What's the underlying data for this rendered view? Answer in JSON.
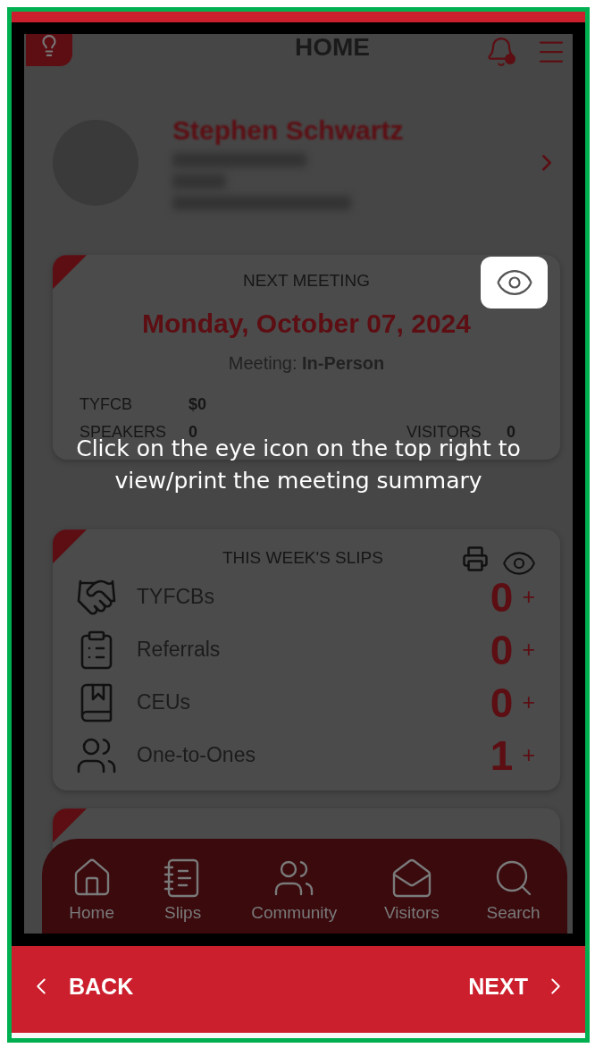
{
  "header": {
    "title": "HOME"
  },
  "profile": {
    "name": "Stephen Schwartz"
  },
  "next_meeting": {
    "heading": "NEXT MEETING",
    "date": "Monday, October 07, 2024",
    "meeting_type": "Meeting: **In-Person**",
    "stats": [
      {
        "label": "TYFCB",
        "value": "$0"
      },
      {
        "label": "SPEAKERS",
        "value": "0"
      },
      {
        "label": "VISITORS",
        "value": "0"
      }
    ]
  },
  "slips": {
    "heading": "THIS WEEK'S SLIPS",
    "rows": [
      {
        "kind": "tyfcb",
        "label": "TYFCBs",
        "count": "0",
        "add": "+"
      },
      {
        "kind": "referral",
        "label": "Referrals",
        "count": "0",
        "add": "+"
      },
      {
        "kind": "ceu",
        "label": "CEUs",
        "count": "0",
        "add": "+"
      },
      {
        "kind": "one_to_one",
        "label": "One-to-Ones",
        "count": "1",
        "add": "+"
      }
    ]
  },
  "bottom_nav": [
    {
      "label": "Home"
    },
    {
      "label": "Slips"
    },
    {
      "label": "Community"
    },
    {
      "label": "Visitors"
    },
    {
      "label": "Search"
    }
  ],
  "tutorial": {
    "message": "Click on the eye icon on the top right to view/print the meeting summary",
    "back": "BACK",
    "next": "NEXT"
  }
}
